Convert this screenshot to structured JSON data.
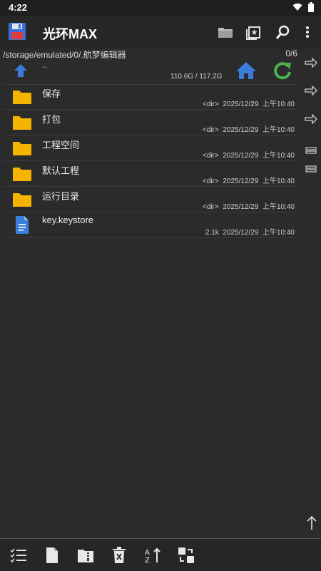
{
  "status": {
    "time": "4:22"
  },
  "app": {
    "title": "光环MAX"
  },
  "path": {
    "current": "/storage/emulated/0/.航梦编辑器",
    "count": "0/6"
  },
  "parent": {
    "label": "..",
    "storage": "110.6G / 117.2G"
  },
  "files": [
    {
      "name": "保存",
      "type": "folder",
      "size": "<dir>",
      "date": "2025/12/29",
      "time": "上午10:40"
    },
    {
      "name": "打包",
      "type": "folder",
      "size": "<dir>",
      "date": "2025/12/29",
      "time": "上午10:40"
    },
    {
      "name": "工程空间",
      "type": "folder",
      "size": "<dir>",
      "date": "2025/12/29",
      "time": "上午10:40"
    },
    {
      "name": "默认工程",
      "type": "folder",
      "size": "<dir>",
      "date": "2025/12/29",
      "time": "上午10:40"
    },
    {
      "name": "运行目录",
      "type": "folder",
      "size": "<dir>",
      "date": "2025/12/29",
      "time": "上午10:40"
    },
    {
      "name": "key.keystore",
      "type": "file",
      "size": "2.1k",
      "date": "2025/12/29",
      "time": "上午10:40"
    }
  ],
  "icons": {
    "app": "floppy-disk-icon",
    "toolbar": [
      "folder-icon",
      "bookmark-star-icon",
      "search-icon",
      "more-vert-icon"
    ],
    "side": [
      "arrow-right-icon",
      "arrow-right-icon",
      "arrow-right-icon",
      "equals-icon",
      "equals-icon"
    ],
    "bottom": [
      "checklist-icon",
      "new-file-icon",
      "archive-icon",
      "delete-icon",
      "sort-icon",
      "swap-icon"
    ]
  },
  "colors": {
    "folder": "#f4b400",
    "accent_blue": "#3b7ddd",
    "refresh_green": "#4caf50"
  }
}
